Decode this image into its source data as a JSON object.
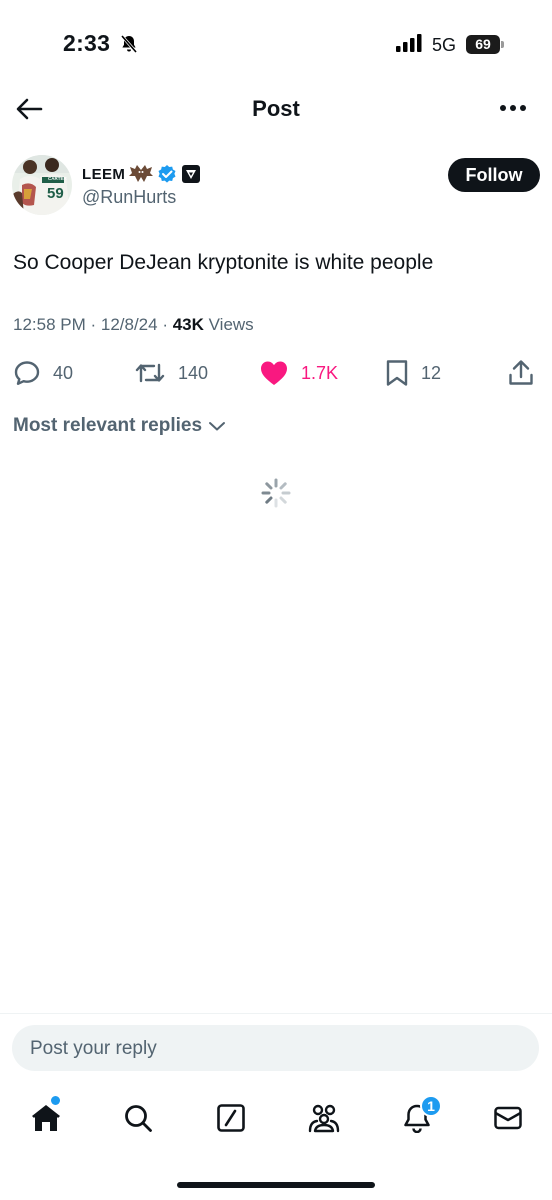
{
  "status_bar": {
    "time": "2:33",
    "network": "5G",
    "battery": "69"
  },
  "header": {
    "title": "Post"
  },
  "author": {
    "display_name": "LEEM",
    "handle": "@RunHurts",
    "follow_label": "Follow",
    "avatar_jersey_number": "59",
    "avatar_jersey_name": "CARTER"
  },
  "tweet": {
    "text": "So Cooper DeJean kryptonite is white people",
    "time": "12:58 PM",
    "date": "12/8/24",
    "views_count": "43K",
    "views_label": "Views"
  },
  "actions": {
    "replies": "40",
    "reposts": "140",
    "likes": "1.7K",
    "bookmarks": "12"
  },
  "replies_sort": {
    "label": "Most relevant replies"
  },
  "reply_box": {
    "placeholder": "Post your reply"
  },
  "tabbar": {
    "notifications_badge": "1"
  },
  "colors": {
    "accent": "#1d9bf0",
    "like": "#f91880",
    "text_primary": "#0f1419",
    "text_secondary": "#536471",
    "reply_bg": "#eff3f4"
  }
}
